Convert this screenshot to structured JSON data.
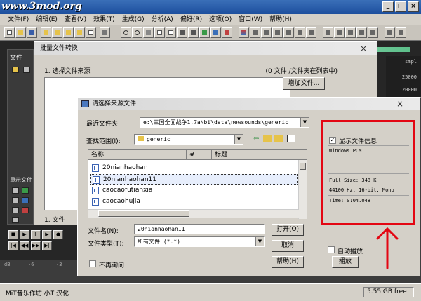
{
  "app": {
    "watermark": "www.3mod.org",
    "menu": [
      "文件(F)",
      "编辑(E)",
      "查看(V)",
      "效果(T)",
      "生成(G)",
      "分析(A)",
      "偏好(R)",
      "选项(O)",
      "窗口(W)",
      "帮助(H)"
    ],
    "side_panel_file_label": "文件",
    "side_panel_display_label": "显示文件",
    "ruler": [
      "smpl",
      "25000",
      "20000"
    ],
    "timeline_labels": [
      "dB",
      "-6",
      "-3",
      "3",
      "-4",
      "-3",
      "-2",
      "-6",
      "-6",
      "-0"
    ],
    "status_left": "MiT音乐作坊 小T 汉化",
    "status_right": "5.55 GB free",
    "accent_color": "#3a6fb8"
  },
  "batch_dialog": {
    "title": "批量文件转换",
    "step1": "1. 选择文件来源",
    "count": "(0 文件 /文件夹在列表中)",
    "add_button": "增加文件...",
    "step_bottom": "1. 文件"
  },
  "open_dialog": {
    "title": "请选择来源文件",
    "recent_label": "最近文件夹:",
    "recent_value": "e:\\三国全面战争1.7a\\bi\\data\\newsounds\\generic",
    "lookin_label": "查找范围(I):",
    "lookin_value": "generic",
    "columns": [
      "名称",
      "#",
      "标题"
    ],
    "files": [
      {
        "name": "20nianhaohan",
        "selected": false
      },
      {
        "name": "20nianhaohan11",
        "selected": true
      },
      {
        "name": "caocaofutianxia",
        "selected": false
      },
      {
        "name": "caocaohujia",
        "selected": false
      }
    ],
    "filename_label": "文件名(N):",
    "filename_value": "20nianhaohan11",
    "filetype_label": "文件类型(T):",
    "filetype_value": "所有文件    (*.*)",
    "open_button": "打开(O)",
    "cancel_button": "取消",
    "help_button": "帮助(H)",
    "dont_ask_label": "不再询问",
    "autoplay_label": "自动播放",
    "play_button": "播放",
    "show_info_label": "显示文件信息",
    "info": {
      "format": "Windows PCM",
      "size": "Full Size: 348 K",
      "quality": "44100 Hz, 16-bit, Mono",
      "time": "Time:    0:04.048"
    },
    "highlight_color": "#e30613"
  }
}
